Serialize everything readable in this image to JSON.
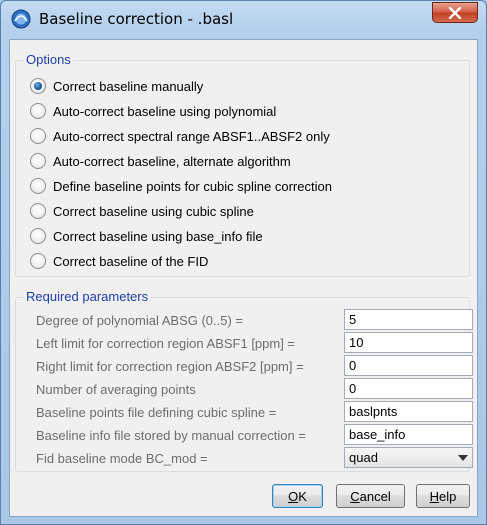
{
  "window": {
    "title": "Baseline correction - .basl",
    "icon": "topspin-app-icon",
    "close_icon": "close-icon"
  },
  "options": {
    "legend": "Options",
    "selected_index": 0,
    "items": [
      {
        "label": "Correct baseline manually",
        "checked": true
      },
      {
        "label": "Auto-correct baseline using polynomial",
        "checked": false
      },
      {
        "label": "Auto-correct spectral range ABSF1..ABSF2 only",
        "checked": false
      },
      {
        "label": "Auto-correct baseline, alternate algorithm",
        "checked": false
      },
      {
        "label": "Define baseline points for cubic spline correction",
        "checked": false
      },
      {
        "label": "Correct baseline using cubic spline",
        "checked": false
      },
      {
        "label": "Correct baseline using base_info file",
        "checked": false
      },
      {
        "label": "Correct baseline of the FID",
        "checked": false
      }
    ]
  },
  "params": {
    "legend": "Required parameters",
    "items": [
      {
        "label": "Degree of polynomial ABSG (0..5) =",
        "value": "5",
        "type": "text"
      },
      {
        "label": "Left limit for correction region ABSF1 [ppm] =",
        "value": "10",
        "type": "text"
      },
      {
        "label": "Right limit for correction region ABSF2 [ppm] =",
        "value": "0",
        "type": "text"
      },
      {
        "label": "Number of averaging points",
        "value": "0",
        "type": "text"
      },
      {
        "label": "Baseline points file defining cubic spline =",
        "value": "baslpnts",
        "type": "text"
      },
      {
        "label": "Baseline info file stored by manual correction =",
        "value": "base_info",
        "type": "text"
      },
      {
        "label": "Fid baseline mode BC_mod =",
        "value": "quad",
        "type": "select"
      }
    ]
  },
  "buttons": {
    "ok": {
      "mnemonic": "O",
      "rest": "K"
    },
    "cancel": {
      "mnemonic": "C",
      "rest": "ancel"
    },
    "help": {
      "mnemonic": "H",
      "rest": "elp"
    }
  },
  "colors": {
    "legend_text": "#1f3fa8",
    "disabled_label": "#6d6d6d",
    "close_button": "#c1401f"
  }
}
